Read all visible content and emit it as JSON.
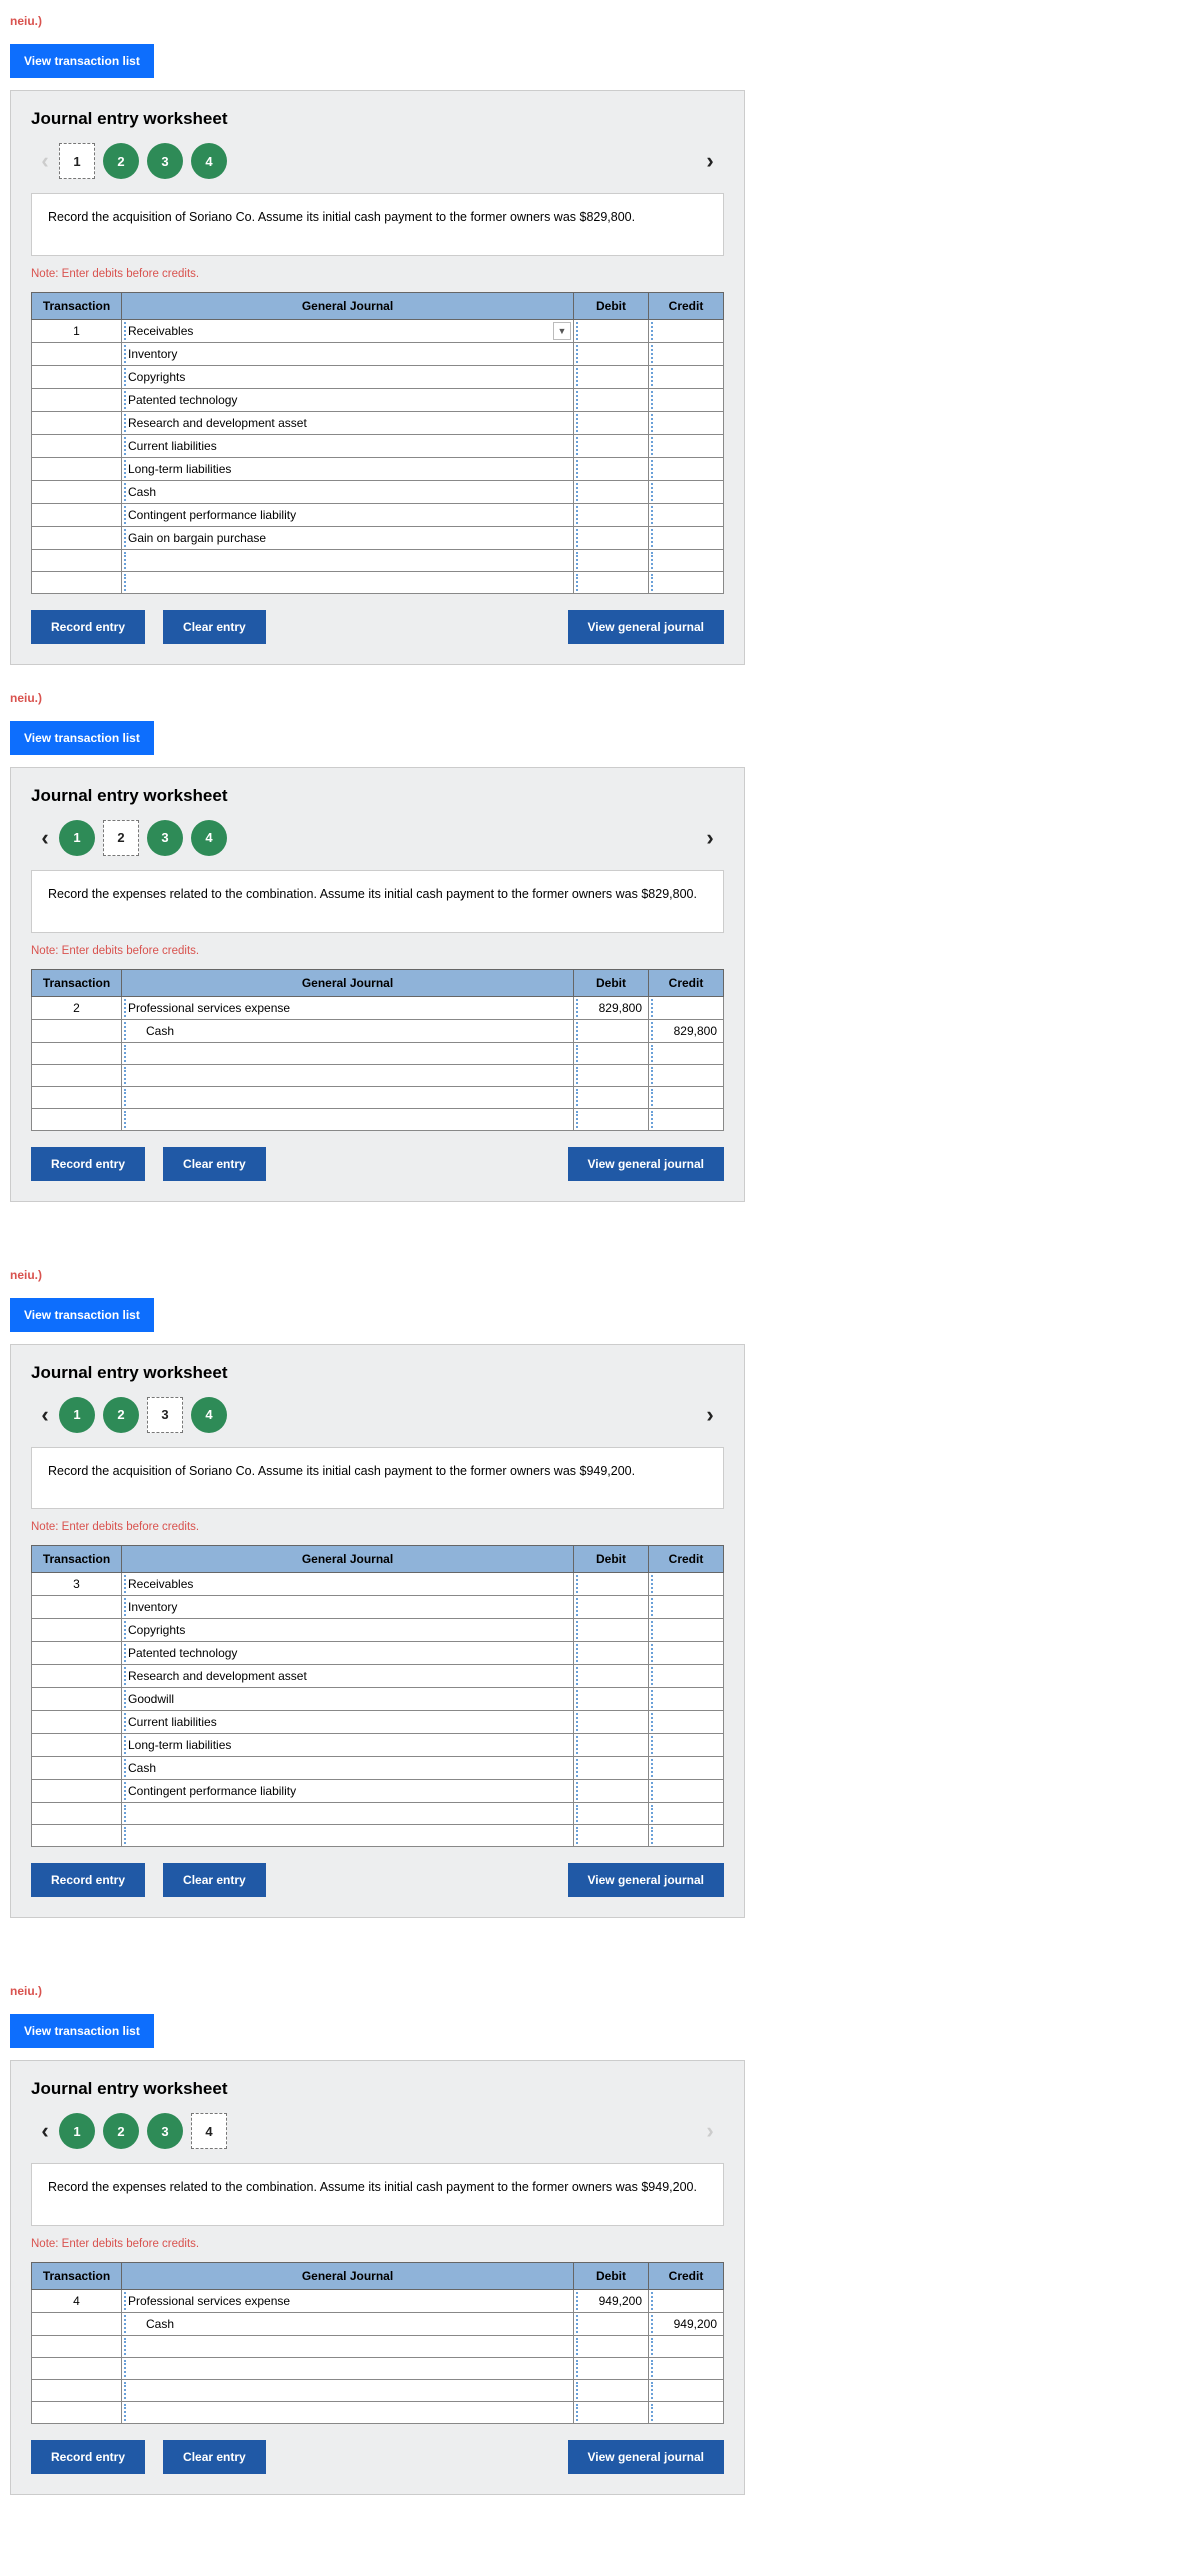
{
  "cutText": "neiu.)",
  "viewBtn": "View transaction list",
  "title": "Journal entry worksheet",
  "note": "Note: Enter debits before credits.",
  "headers": {
    "transaction": "Transaction",
    "journal": "General Journal",
    "debit": "Debit",
    "credit": "Credit"
  },
  "actions": {
    "record": "Record entry",
    "clear": "Clear entry",
    "view": "View general journal"
  },
  "ws": [
    {
      "tabs": [
        {
          "n": "1",
          "sel": true
        },
        {
          "n": "2"
        },
        {
          "n": "3"
        },
        {
          "n": "4"
        }
      ],
      "leftDim": true,
      "rightDim": false,
      "prompt": "Record the acquisition of Soriano Co. Assume its initial cash payment to the former owners was $829,800.",
      "tx": "1",
      "rows": [
        {
          "acct": "Receivables",
          "dd": true
        },
        {
          "acct": "Inventory"
        },
        {
          "acct": "Copyrights"
        },
        {
          "acct": "Patented technology"
        },
        {
          "acct": "Research and development asset"
        },
        {
          "acct": "Current liabilities"
        },
        {
          "acct": "Long-term liabilities"
        },
        {
          "acct": "Cash"
        },
        {
          "acct": "Contingent performance liability"
        },
        {
          "acct": "Gain on bargain purchase"
        },
        {
          "acct": ""
        },
        {
          "acct": ""
        }
      ]
    },
    {
      "tabs": [
        {
          "n": "1"
        },
        {
          "n": "2",
          "sel": true
        },
        {
          "n": "3"
        },
        {
          "n": "4"
        }
      ],
      "leftDim": false,
      "rightDim": false,
      "prompt": "Record the expenses related to the combination. Assume its initial cash payment to the former owners was $829,800.",
      "tx": "2",
      "rows": [
        {
          "acct": "Professional services expense",
          "debit": "829,800"
        },
        {
          "acct": "Cash",
          "indent": true,
          "credit": "829,800"
        },
        {
          "acct": ""
        },
        {
          "acct": ""
        },
        {
          "acct": ""
        },
        {
          "acct": ""
        }
      ]
    },
    {
      "tabs": [
        {
          "n": "1"
        },
        {
          "n": "2"
        },
        {
          "n": "3",
          "sel": true
        },
        {
          "n": "4"
        }
      ],
      "leftDim": false,
      "rightDim": false,
      "prompt": "Record the acquisition of Soriano Co. Assume its initial cash payment to the former owners was $949,200.",
      "tx": "3",
      "rows": [
        {
          "acct": "Receivables"
        },
        {
          "acct": "Inventory"
        },
        {
          "acct": "Copyrights"
        },
        {
          "acct": "Patented technology"
        },
        {
          "acct": "Research and development asset"
        },
        {
          "acct": "Goodwill"
        },
        {
          "acct": "Current liabilities"
        },
        {
          "acct": "Long-term liabilities"
        },
        {
          "acct": "Cash"
        },
        {
          "acct": "Contingent performance liability"
        },
        {
          "acct": ""
        },
        {
          "acct": ""
        }
      ]
    },
    {
      "tabs": [
        {
          "n": "1"
        },
        {
          "n": "2"
        },
        {
          "n": "3"
        },
        {
          "n": "4",
          "sel": true
        }
      ],
      "leftDim": false,
      "rightDim": true,
      "prompt": "Record the expenses related to the combination. Assume its initial cash payment to the former owners was $949,200.",
      "tx": "4",
      "rows": [
        {
          "acct": "Professional services expense",
          "debit": "949,200"
        },
        {
          "acct": "Cash",
          "indent": true,
          "credit": "949,200"
        },
        {
          "acct": ""
        },
        {
          "acct": ""
        },
        {
          "acct": ""
        },
        {
          "acct": ""
        }
      ]
    }
  ]
}
